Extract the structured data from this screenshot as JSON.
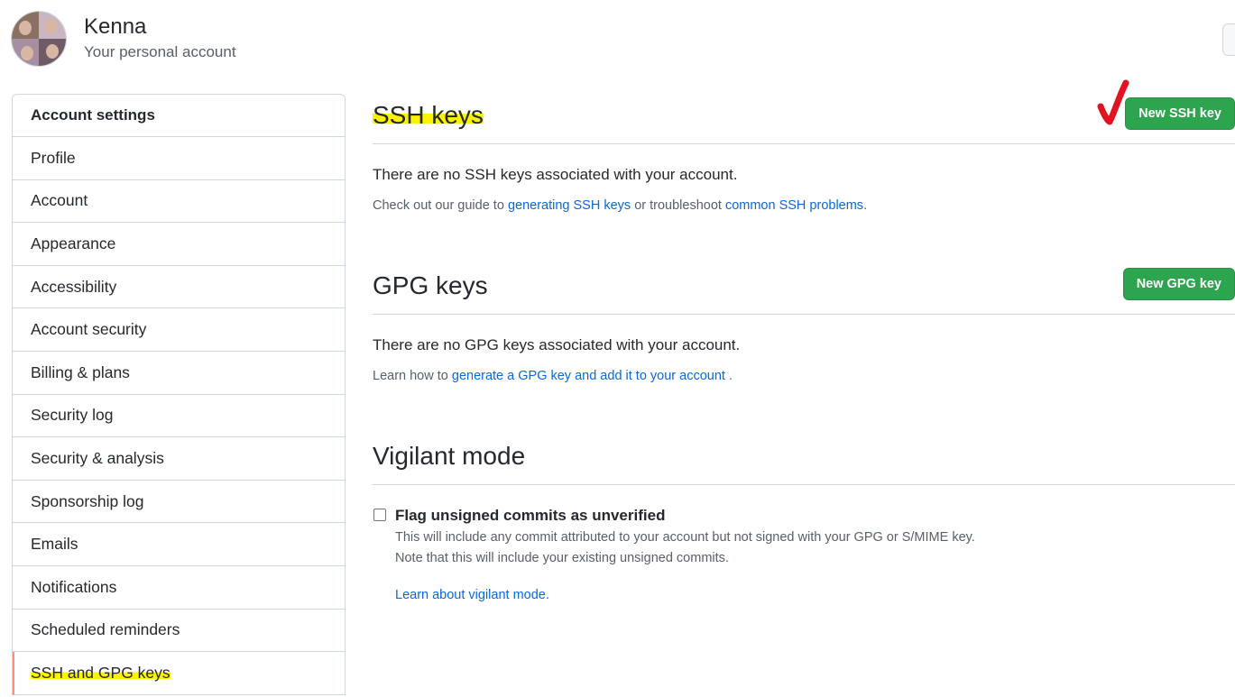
{
  "profile": {
    "name": "Kenna",
    "subtitle": "Your personal account"
  },
  "sidebar": {
    "heading": "Account settings",
    "items": [
      {
        "label": "Profile"
      },
      {
        "label": "Account"
      },
      {
        "label": "Appearance"
      },
      {
        "label": "Accessibility"
      },
      {
        "label": "Account security"
      },
      {
        "label": "Billing & plans"
      },
      {
        "label": "Security log"
      },
      {
        "label": "Security & analysis"
      },
      {
        "label": "Sponsorship log"
      },
      {
        "label": "Emails"
      },
      {
        "label": "Notifications"
      },
      {
        "label": "Scheduled reminders"
      },
      {
        "label": "SSH and GPG keys",
        "active": true
      }
    ]
  },
  "ssh": {
    "title": "SSH keys",
    "button": "New SSH key",
    "empty": "There are no SSH keys associated with your account.",
    "help_prefix": "Check out our guide to",
    "help_link1": "generating SSH keys",
    "help_mid": "or troubleshoot",
    "help_link2": "common SSH problems",
    "help_suffix": "."
  },
  "gpg": {
    "title": "GPG keys",
    "button": "New GPG key",
    "empty": "There are no GPG keys associated with your account.",
    "help_prefix": "Learn how to",
    "help_link": "generate a GPG key and add it to your account",
    "help_suffix": "."
  },
  "vigilant": {
    "title": "Vigilant mode",
    "checkbox_label": "Flag unsigned commits as unverified",
    "checked": false,
    "note_line1": "This will include any commit attributed to your account but not signed with your GPG or S/MIME key.",
    "note_line2": "Note that this will include your existing unsigned commits.",
    "learn_link": "Learn about vigilant mode."
  },
  "colors": {
    "accent_green": "#2da44e",
    "link_blue": "#0969da",
    "highlight_yellow": "#fff200",
    "annotation_red": "#e0141e"
  }
}
